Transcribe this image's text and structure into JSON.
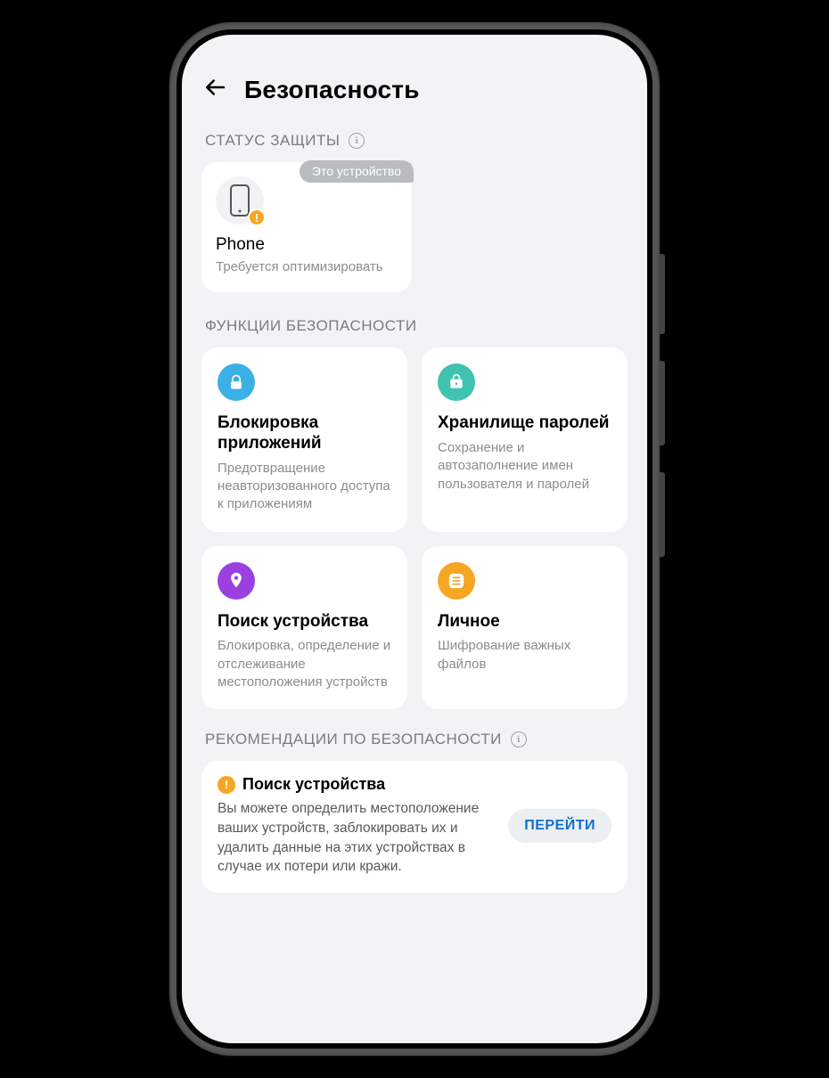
{
  "header": {
    "title": "Безопасность"
  },
  "status": {
    "section_label": "СТАТУС ЗАЩИТЫ",
    "badge": "Это устройство",
    "device_name": "Phone",
    "device_sub": "Требуется оптимизировать"
  },
  "features": {
    "section_label": "ФУНКЦИИ БЕЗОПАСНОСТИ",
    "items": [
      {
        "icon": "lock-icon",
        "color": "#3bb0e6",
        "title": "Блокировка приложений",
        "desc": "Предотвращение неавторизованного доступа к приложениям"
      },
      {
        "icon": "bag-lock-icon",
        "color": "#3fc3b0",
        "title": "Хранилище паролей",
        "desc": "Сохранение и автозаполнение имен пользователя и паролей"
      },
      {
        "icon": "pin-icon",
        "color": "#9b3fe0",
        "title": "Поиск устройства",
        "desc": "Блокировка, определение и отслеживание местоположения устройств"
      },
      {
        "icon": "drive-icon",
        "color": "#f5a623",
        "title": "Личное",
        "desc": "Шифрование важных файлов"
      }
    ]
  },
  "recs": {
    "section_label": "РЕКОМЕНДАЦИИ ПО БЕЗОПАСНОСТИ",
    "item": {
      "title": "Поиск устройства",
      "desc": "Вы можете определить местоположение ваших устройств, заблокировать их и удалить данные на этих устройствах в случае их потери или кражи.",
      "action": "ПЕРЕЙТИ"
    }
  }
}
